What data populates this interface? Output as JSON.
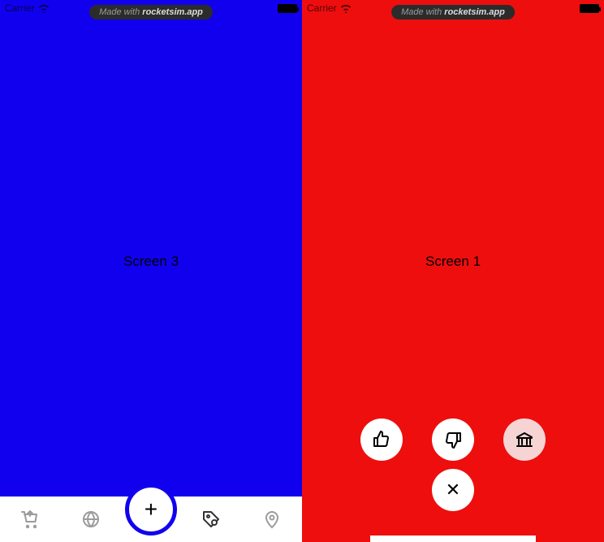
{
  "left": {
    "status": {
      "carrier": "Carrier"
    },
    "pill_prefix": "Made with ",
    "pill_brand": "rocketsim.app",
    "screen_label": "Screen 3",
    "tabs": {
      "cart": "cart-icon",
      "globe": "globe-icon",
      "plus": "+",
      "tag": "price-tag-icon",
      "pin": "location-pin-icon"
    }
  },
  "right": {
    "status": {
      "carrier": "Carrier"
    },
    "pill_prefix": "Made with ",
    "pill_brand": "rocketsim.app",
    "screen_label": "Screen 1",
    "fabs": {
      "like": "thumbs-up-icon",
      "dislike": "thumbs-down-icon",
      "bank": "bank-icon",
      "close": "✕"
    }
  }
}
